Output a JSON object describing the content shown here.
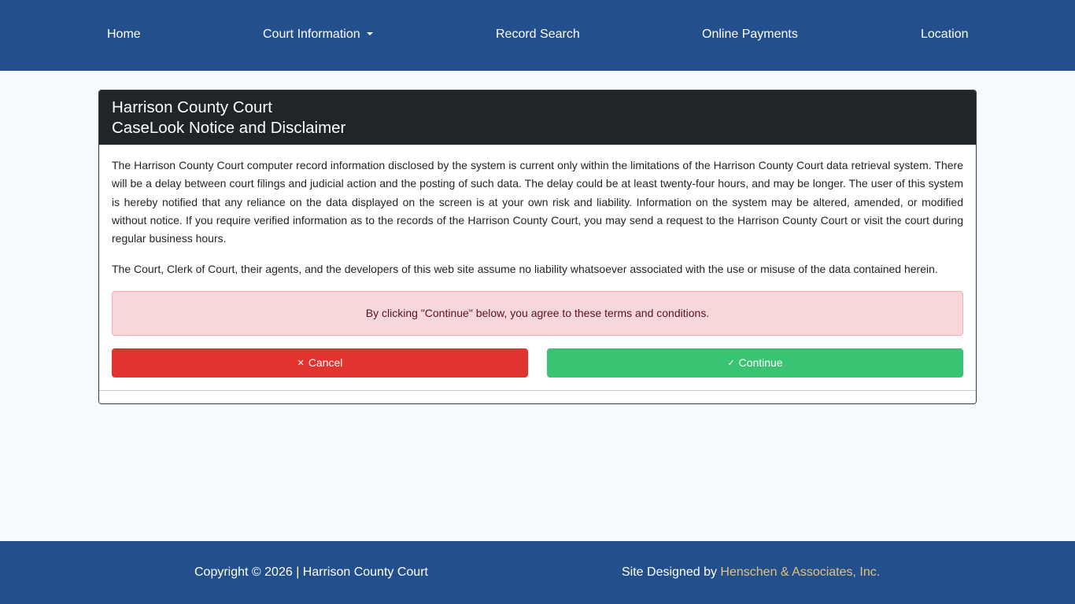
{
  "nav": {
    "home": "Home",
    "court_information": "Court Information",
    "record_search": "Record Search",
    "online_payments": "Online Payments",
    "location": "Location"
  },
  "card": {
    "title_line1": "Harrison County Court",
    "title_line2": "CaseLook Notice and Disclaimer",
    "paragraph1": "The Harrison County Court computer record information disclosed by the system is current only within the limitations of the Harrison County Court data retrieval system. There will be a delay between court filings and judicial action and the posting of such data. The delay could be at least twenty-four hours, and may be longer. The user of this system is hereby notified that any reliance on the data displayed on the screen is at your own risk and liability. Information on the system may be altered, amended, or modified without notice. If you require verified information as to the records of the Harrison County Court, you may send a request to the Harrison County Court or visit the court during regular business hours.",
    "paragraph2": "The Court, Clerk of Court, their agents, and the developers of this web site assume no liability whatsoever associated with the use or misuse of the data contained herein.",
    "alert": "By clicking \"Continue\" below, you agree to these terms and conditions.",
    "cancel_label": "Cancel",
    "continue_label": "Continue",
    "cancel_icon": "close-icon",
    "continue_icon": "check-icon"
  },
  "footer": {
    "copyright": "Copyright © 2026 | Harrison County Court",
    "designed_by": "Site Designed by",
    "designer": "Henschen & Associates, Inc."
  },
  "colors": {
    "nav_bg": "#234f8c",
    "header_bg": "#212529",
    "cancel": "#e1342f",
    "continue": "#3ac372",
    "alert_bg": "#f8d7da",
    "link": "#e3c27a"
  }
}
